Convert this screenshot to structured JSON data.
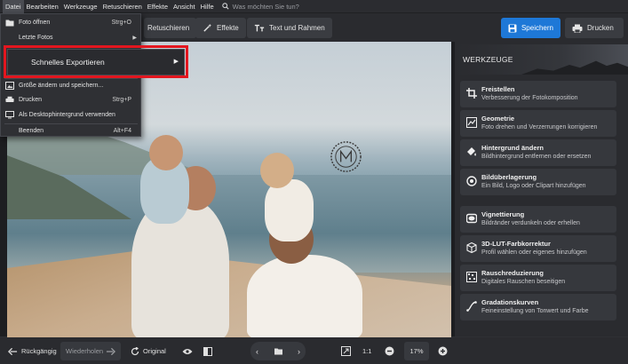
{
  "menubar": {
    "items": [
      "Datei",
      "Bearbeiten",
      "Werkzeuge",
      "Retuschieren",
      "Effekte",
      "Ansicht",
      "Hilfe"
    ],
    "search_placeholder": "Was möchten Sie tun?"
  },
  "toolbar": {
    "retouch": "Retuschieren",
    "effects": "Effekte",
    "text_frame": "Text und Rahmen",
    "save": "Speichern",
    "print": "Drucken"
  },
  "file_menu": {
    "open": "Foto öffnen",
    "open_shortcut": "Strg+O",
    "recent": "Letzte Fotos",
    "quick_export": "Schnelles Exportieren",
    "resize_save": "Größe ändern und speichern...",
    "print": "Drucken",
    "print_shortcut": "Strg+P",
    "wallpaper": "Als Desktophintergrund verwenden",
    "exit": "Beenden",
    "exit_shortcut": "Alt+F4"
  },
  "panel": {
    "title": "WERKZEUGE",
    "tools": [
      {
        "name": "Freistellen",
        "desc": "Verbesserung der Fotokomposition",
        "icon": "crop-icon"
      },
      {
        "name": "Geometrie",
        "desc": "Foto drehen und Verzerrungen korrigieren",
        "icon": "geometry-icon"
      },
      {
        "name": "Hintergrund ändern",
        "desc": "Bildhintergrund entfernen oder ersetzen",
        "icon": "paint-bucket-icon"
      },
      {
        "name": "Bildüberlagerung",
        "desc": "Ein Bild, Logo oder Clipart hinzufügen",
        "icon": "overlay-icon"
      },
      {
        "name": "Vignettierung",
        "desc": "Bildränder verdunkeln oder erhellen",
        "icon": "vignette-icon"
      },
      {
        "name": "3D-LUT-Farbkorrektur",
        "desc": "Profil wählen oder eigenes hinzufügen",
        "icon": "lut-cube-icon"
      },
      {
        "name": "Rauschreduzierung",
        "desc": "Digitales Rauschen beseitigen",
        "icon": "noise-icon"
      },
      {
        "name": "Gradationskurven",
        "desc": "Feineinstellung von Tonwert und Farbe",
        "icon": "curves-icon"
      }
    ]
  },
  "bottombar": {
    "undo": "Rückgängig",
    "redo": "Wiederholen",
    "original": "Original",
    "ratio": "1:1",
    "zoom": "17%"
  },
  "colors": {
    "accent": "#1e78d7",
    "highlight": "#e3161f"
  }
}
